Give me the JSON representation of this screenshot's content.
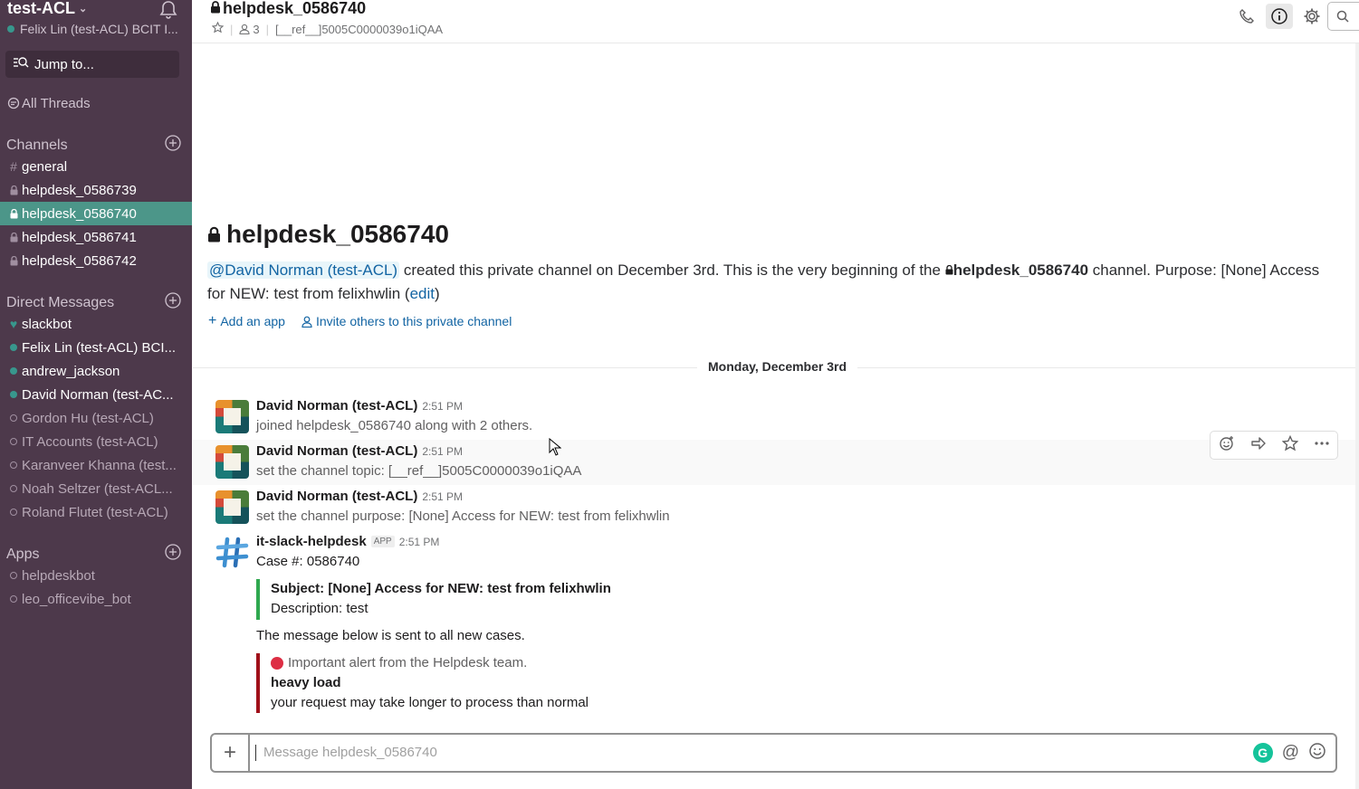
{
  "workspace": {
    "name": "test-ACL",
    "user": "Felix Lin (test-ACL) BCIT I...",
    "jump_placeholder": "Jump to...",
    "all_threads": "All Threads"
  },
  "channels": {
    "header": "Channels",
    "items": [
      {
        "name": "general",
        "prefix": "#"
      },
      {
        "name": "helpdesk_0586739",
        "prefix": "lock"
      },
      {
        "name": "helpdesk_0586740",
        "prefix": "lock",
        "active": true
      },
      {
        "name": "helpdesk_0586741",
        "prefix": "lock"
      },
      {
        "name": "helpdesk_0586742",
        "prefix": "lock"
      }
    ]
  },
  "direct_messages": {
    "header": "Direct Messages",
    "items": [
      {
        "name": "slackbot",
        "status": "heart"
      },
      {
        "name": "Felix Lin (test-ACL) BCI...",
        "status": "online"
      },
      {
        "name": "andrew_jackson",
        "status": "online"
      },
      {
        "name": "David Norman (test-AC...",
        "status": "online"
      },
      {
        "name": "Gordon Hu (test-ACL)",
        "status": "away"
      },
      {
        "name": "IT Accounts (test-ACL)",
        "status": "away"
      },
      {
        "name": "Karanveer Khanna (test...",
        "status": "away"
      },
      {
        "name": "Noah Seltzer (test-ACL...",
        "status": "away"
      },
      {
        "name": "Roland Flutet (test-ACL)",
        "status": "away"
      }
    ]
  },
  "apps": {
    "header": "Apps",
    "items": [
      {
        "name": "helpdeskbot"
      },
      {
        "name": "leo_officevibe_bot"
      }
    ]
  },
  "header": {
    "channel": "helpdesk_0586740",
    "members": "3",
    "topic": "[__ref__]5005C0000039o1iQAA"
  },
  "intro": {
    "title": "helpdesk_0586740",
    "mention": "@David Norman (test-ACL)",
    "text_1": " created this private channel on December 3rd. This is the very beginning of the ",
    "channel": "helpdesk_0586740",
    "text_2": " channel. Purpose: [None] Access for NEW: test from felixhwlin (",
    "edit": "edit",
    "text_3": ")",
    "add_app": "Add an app",
    "invite": "Invite others to this private channel"
  },
  "day_divider": "Monday, December 3rd",
  "messages": [
    {
      "author": "David Norman (test-ACL)",
      "time": "2:51 PM",
      "text": "joined helpdesk_0586740 along with 2 others."
    },
    {
      "author": "David Norman (test-ACL)",
      "time": "2:51 PM",
      "text": "set the channel topic: [__ref__]5005C0000039o1iQAA"
    },
    {
      "author": "David Norman (test-ACL)",
      "time": "2:51 PM",
      "text": "set the channel purpose: [None] Access for NEW: test from felixhwlin"
    },
    {
      "author": "it-slack-helpdesk",
      "badge": "APP",
      "time": "2:51 PM",
      "text": "Case #: 0586740"
    }
  ],
  "attachment_1": {
    "subject": "Subject: [None] Access for NEW: test from felixhwlin",
    "description": "Description: test"
  },
  "plain_message": "The message below is sent to all new cases.",
  "attachment_2": {
    "alert": "Important alert from the Helpdesk team.",
    "title": "heavy load",
    "body": "your request may take longer to process than normal"
  },
  "composer": {
    "placeholder": "Message helpdesk_0586740"
  },
  "colors": {
    "sidebar": "#4d394b",
    "active": "#4c9689",
    "link": "#1264a3",
    "green_bar": "#2fa84f",
    "red_bar": "#a0101a"
  }
}
